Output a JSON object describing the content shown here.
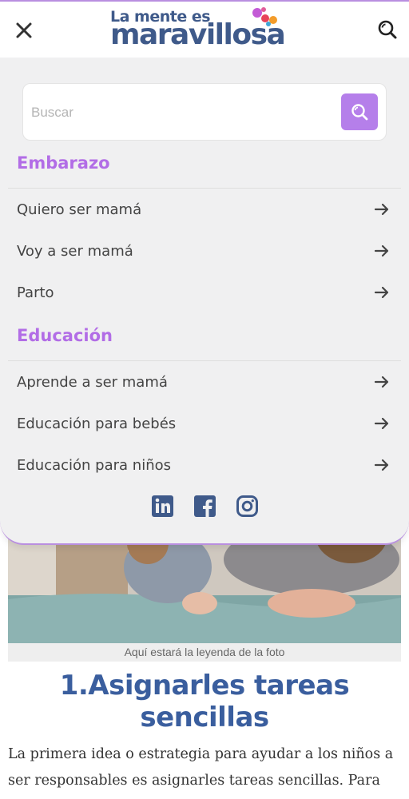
{
  "header": {
    "logo_top": "La mente es",
    "logo_main": "maravillosa",
    "close_icon": "close-icon",
    "search_icon": "search-icon"
  },
  "menu": {
    "search": {
      "placeholder": "Buscar",
      "value": ""
    },
    "sections": [
      {
        "title": "Embarazo",
        "items": [
          {
            "label": "Quiero ser mamá"
          },
          {
            "label": "Voy a ser mamá"
          },
          {
            "label": "Parto"
          }
        ]
      },
      {
        "title": "Educación",
        "items": [
          {
            "label": "Aprende a ser mamá"
          },
          {
            "label": "Educación para bebés"
          },
          {
            "label": "Educación para niños"
          }
        ]
      }
    ],
    "social": [
      "linkedin-icon",
      "facebook-icon",
      "instagram-icon"
    ]
  },
  "article": {
    "caption": "Aquí estará la leyenda de la foto",
    "title": "1.Asignarles tareas sencillas",
    "body": "La primera idea o estrategia para ayudar a los niños a ser responsables es asignarles tareas sencillas. Para que la tarea sea más fácil, puedes comenzar por ti..."
  },
  "colors": {
    "accent": "#b57fea",
    "section_title": "#b26de6",
    "brand_blue": "#3f5a8a",
    "title_blue": "#3a5e9e",
    "menu_bg": "#f0f0f1"
  }
}
